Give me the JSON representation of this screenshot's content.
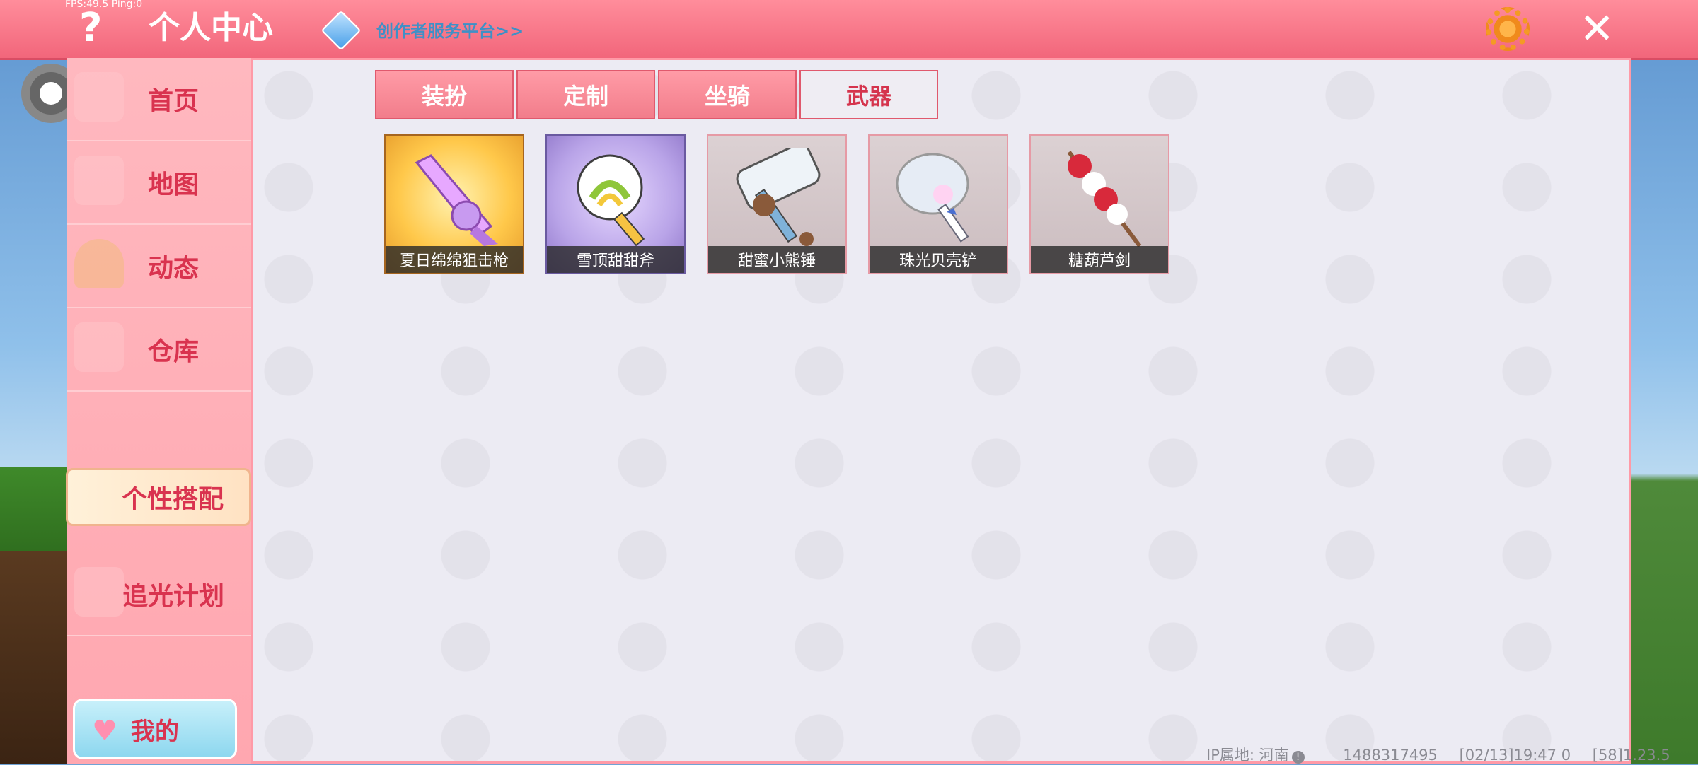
{
  "topbar": {
    "fps_text": "FPS:49.5  Ping:0",
    "title": "个人中心",
    "creator_link": "创作者服务平台>>"
  },
  "sidebar": {
    "items": [
      {
        "label": "首页"
      },
      {
        "label": "地图"
      },
      {
        "label": "动态"
      },
      {
        "label": "仓库"
      },
      {
        "label": "个性搭配",
        "active": true
      },
      {
        "label": "追光计划"
      }
    ],
    "my_button": "我的"
  },
  "tabs": [
    {
      "label": "装扮"
    },
    {
      "label": "定制"
    },
    {
      "label": "坐骑"
    },
    {
      "label": "武器",
      "active": true
    }
  ],
  "items": [
    {
      "name": "夏日绵绵狙击枪",
      "style": "orange",
      "icon": "sniper-rifle-icon"
    },
    {
      "name": "雪顶甜甜斧",
      "style": "purple",
      "icon": "lollipop-axe-icon"
    },
    {
      "name": "甜蜜小熊锤",
      "style": "grey",
      "icon": "bear-hammer-icon"
    },
    {
      "name": "珠光贝壳铲",
      "style": "grey",
      "icon": "shell-shovel-icon"
    },
    {
      "name": "糖葫芦剑",
      "style": "grey",
      "icon": "candied-haws-sword-icon"
    }
  ],
  "status": {
    "ip_location": "IP属地: 河南",
    "user_id": "1488317495",
    "timestamp": "[02/13]19:47 0",
    "version": "[58]1.23.5"
  },
  "colors": {
    "accent": "#f2667b",
    "tab_active_text": "#d5344d",
    "sidebar_text": "#d9334f"
  }
}
